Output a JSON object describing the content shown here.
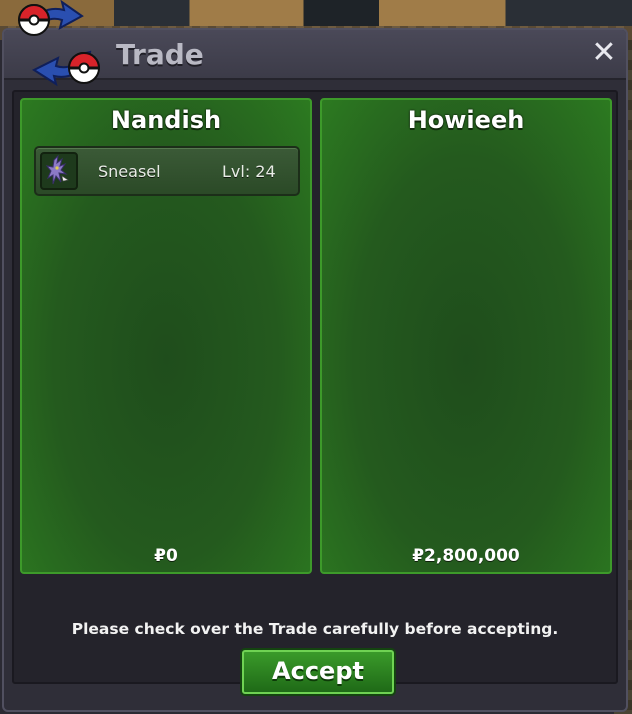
{
  "window": {
    "title": "Trade",
    "close_symbol": "✕",
    "logo_icon": "trade-swap-pokeball-icon",
    "accent_green": "#2c7a20",
    "border_green": "#3d9a2a"
  },
  "left_panel": {
    "player_name": "Nandish",
    "items": [
      {
        "icon": "sneasel-sprite-icon",
        "name": "Sneasel",
        "level": "Lvl: 24"
      }
    ],
    "money": "₽0"
  },
  "right_panel": {
    "player_name": "Howieeh",
    "items": [],
    "money": "₽2,800,000"
  },
  "footer": {
    "notice": "Please check over the Trade carefully before accepting.",
    "accept_label": "Accept"
  }
}
